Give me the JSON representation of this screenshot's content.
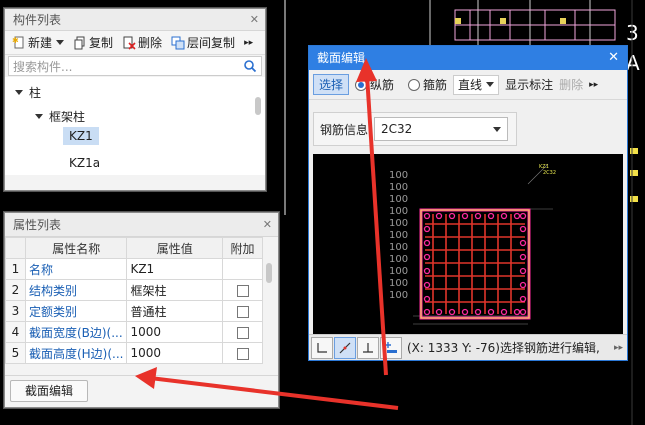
{
  "component_list": {
    "title": "构件列表",
    "toolbar": {
      "new": "新建",
      "copy": "复制",
      "delete": "删除",
      "floor_copy": "层间复制",
      "more": "▸▸"
    },
    "search_placeholder": "搜索构件...",
    "tree": {
      "root": "柱",
      "group": "框架柱",
      "items": [
        "KZ1",
        "KZ1a"
      ]
    }
  },
  "property_list": {
    "title": "属性列表",
    "headers": [
      "属性名称",
      "属性值",
      "附加"
    ],
    "rows": [
      {
        "idx": "1",
        "name": "名称",
        "value": "KZ1"
      },
      {
        "idx": "2",
        "name": "结构类别",
        "value": "框架柱"
      },
      {
        "idx": "3",
        "name": "定额类别",
        "value": "普通柱"
      },
      {
        "idx": "4",
        "name": "截面宽度(B边)(...",
        "value": "1000"
      },
      {
        "idx": "5",
        "name": "截面高度(H边)(...",
        "value": "1000"
      }
    ],
    "section_edit_button": "截面编辑"
  },
  "section_editor": {
    "title": "截面编辑",
    "select_button": "选择",
    "radio_longitudinal": "纵筋",
    "radio_stirrup": "箍筋",
    "line_mode": "直线",
    "show_labels": "显示标注",
    "delete": "删除",
    "rebar_info_label": "钢筋信息",
    "rebar_info_value": "2C32",
    "status": "(X: 1333 Y: -76)选择钢筋进行编辑,"
  },
  "colors": {
    "accent": "#2f7fe3",
    "rebar": "#ff2aa0",
    "stirrup": "#e0352b",
    "arrow": "#e8322a"
  }
}
